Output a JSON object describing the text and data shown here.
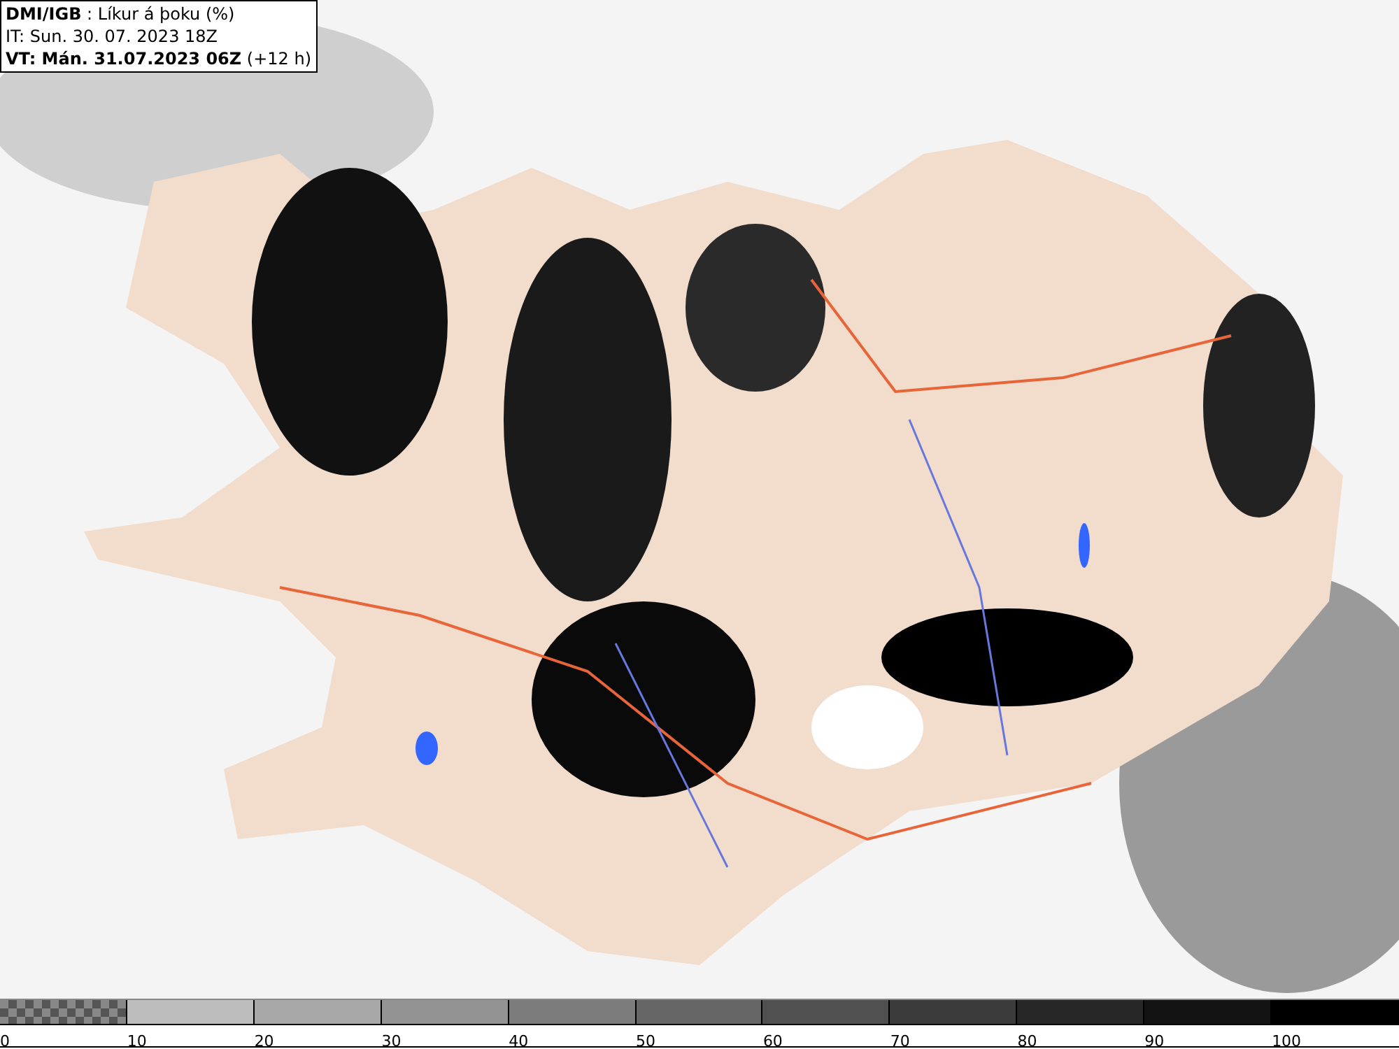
{
  "info_box": {
    "lines": [
      "**DMI/IGB** : Líkur á þoku (%)",
      "IT: Sun. 30. 07. 2023 18Z",
      "**VT: Mán. 31.07.2023 06Z** (+12 h)"
    ]
  },
  "legend": {
    "segments": [
      {
        "kind": "checker",
        "color": "#555555"
      },
      {
        "kind": "solid",
        "color": "#bdbdbd"
      },
      {
        "kind": "solid",
        "color": "#a8a8a8"
      },
      {
        "kind": "solid",
        "color": "#939393"
      },
      {
        "kind": "solid",
        "color": "#7c7c7c"
      },
      {
        "kind": "solid",
        "color": "#666666"
      },
      {
        "kind": "solid",
        "color": "#505050"
      },
      {
        "kind": "solid",
        "color": "#3b3b3b"
      },
      {
        "kind": "solid",
        "color": "#272727"
      },
      {
        "kind": "solid",
        "color": "#131313"
      },
      {
        "kind": "solid",
        "color": "#000000"
      }
    ],
    "labels": [
      "0",
      "10",
      "20",
      "30",
      "40",
      "50",
      "60",
      "70",
      "80",
      "90",
      "100"
    ]
  }
}
